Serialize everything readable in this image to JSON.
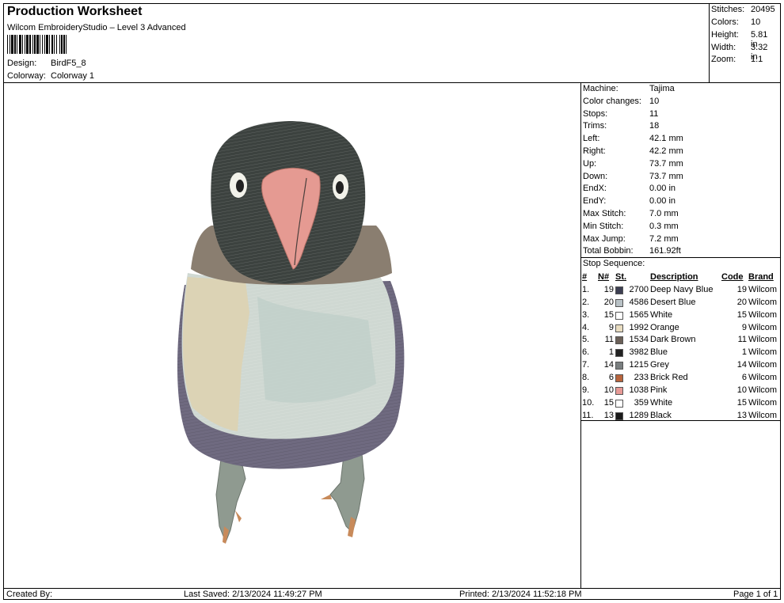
{
  "header": {
    "title": "Production Worksheet",
    "software": "Wilcom EmbroideryStudio – Level 3 Advanced",
    "design_label": "Design:",
    "design_value": "BirdF5_8",
    "colorway_label": "Colorway:",
    "colorway_value": "Colorway 1"
  },
  "summary": [
    {
      "label": "Stitches:",
      "value": "20495"
    },
    {
      "label": "Colors:",
      "value": "10"
    },
    {
      "label": "Height:",
      "value": "5.81 in"
    },
    {
      "label": "Width:",
      "value": "3.32 in"
    },
    {
      "label": "Zoom:",
      "value": "1:1"
    }
  ],
  "specs": [
    {
      "label": "Machine:",
      "value": "Tajima"
    },
    {
      "label": "Color changes:",
      "value": "10"
    },
    {
      "label": "Stops:",
      "value": "11"
    },
    {
      "label": "Trims:",
      "value": "18"
    },
    {
      "label": "Left:",
      "value": "42.1 mm"
    },
    {
      "label": "Right:",
      "value": "42.2 mm"
    },
    {
      "label": "Up:",
      "value": "73.7 mm"
    },
    {
      "label": "Down:",
      "value": "73.7 mm"
    },
    {
      "label": "EndX:",
      "value": "0.00 in"
    },
    {
      "label": "EndY:",
      "value": "0.00 in"
    },
    {
      "label": "Max Stitch:",
      "value": "7.0 mm"
    },
    {
      "label": "Min Stitch:",
      "value": "0.3 mm"
    },
    {
      "label": "Max Jump:",
      "value": "7.2 mm"
    },
    {
      "label": "Total Bobbin:",
      "value": "161.92ft"
    }
  ],
  "stop_sequence": {
    "title": "Stop Sequence:",
    "headers": [
      "#",
      "N#",
      "St.",
      "Description",
      "Code",
      "Brand"
    ],
    "rows": [
      {
        "idx": "1.",
        "n": "19",
        "color": "#3d3f52",
        "st": "2700",
        "desc": "Deep Navy Blue",
        "code": "19",
        "brand": "Wilcom"
      },
      {
        "idx": "2.",
        "n": "20",
        "color": "#b9c2c6",
        "st": "4586",
        "desc": "Desert Blue",
        "code": "20",
        "brand": "Wilcom"
      },
      {
        "idx": "3.",
        "n": "15",
        "color": "#ffffff",
        "st": "1565",
        "desc": "White",
        "code": "15",
        "brand": "Wilcom"
      },
      {
        "idx": "4.",
        "n": "9",
        "color": "#e8dcc0",
        "st": "1992",
        "desc": "Orange",
        "code": "9",
        "brand": "Wilcom"
      },
      {
        "idx": "5.",
        "n": "11",
        "color": "#6b6058",
        "st": "1534",
        "desc": "Dark Brown",
        "code": "11",
        "brand": "Wilcom"
      },
      {
        "idx": "6.",
        "n": "1",
        "color": "#222222",
        "st": "3982",
        "desc": "Blue",
        "code": "1",
        "brand": "Wilcom"
      },
      {
        "idx": "7.",
        "n": "14",
        "color": "#7a7f80",
        "st": "1215",
        "desc": "Grey",
        "code": "14",
        "brand": "Wilcom"
      },
      {
        "idx": "8.",
        "n": "6",
        "color": "#b8643c",
        "st": "233",
        "desc": "Brick Red",
        "code": "6",
        "brand": "Wilcom"
      },
      {
        "idx": "9.",
        "n": "10",
        "color": "#e79a96",
        "st": "1038",
        "desc": "Pink",
        "code": "10",
        "brand": "Wilcom"
      },
      {
        "idx": "10.",
        "n": "15",
        "color": "#ffffff",
        "st": "359",
        "desc": "White",
        "code": "15",
        "brand": "Wilcom"
      },
      {
        "idx": "11.",
        "n": "13",
        "color": "#1a1a1a",
        "st": "1289",
        "desc": "Black",
        "code": "13",
        "brand": "Wilcom"
      }
    ]
  },
  "footer": {
    "created_by": "Created By:",
    "last_saved": "Last Saved: 2/13/2024 11:49:27 PM",
    "printed": "Printed: 2/13/2024 11:52:18 PM",
    "page": "Page 1 of 1"
  }
}
